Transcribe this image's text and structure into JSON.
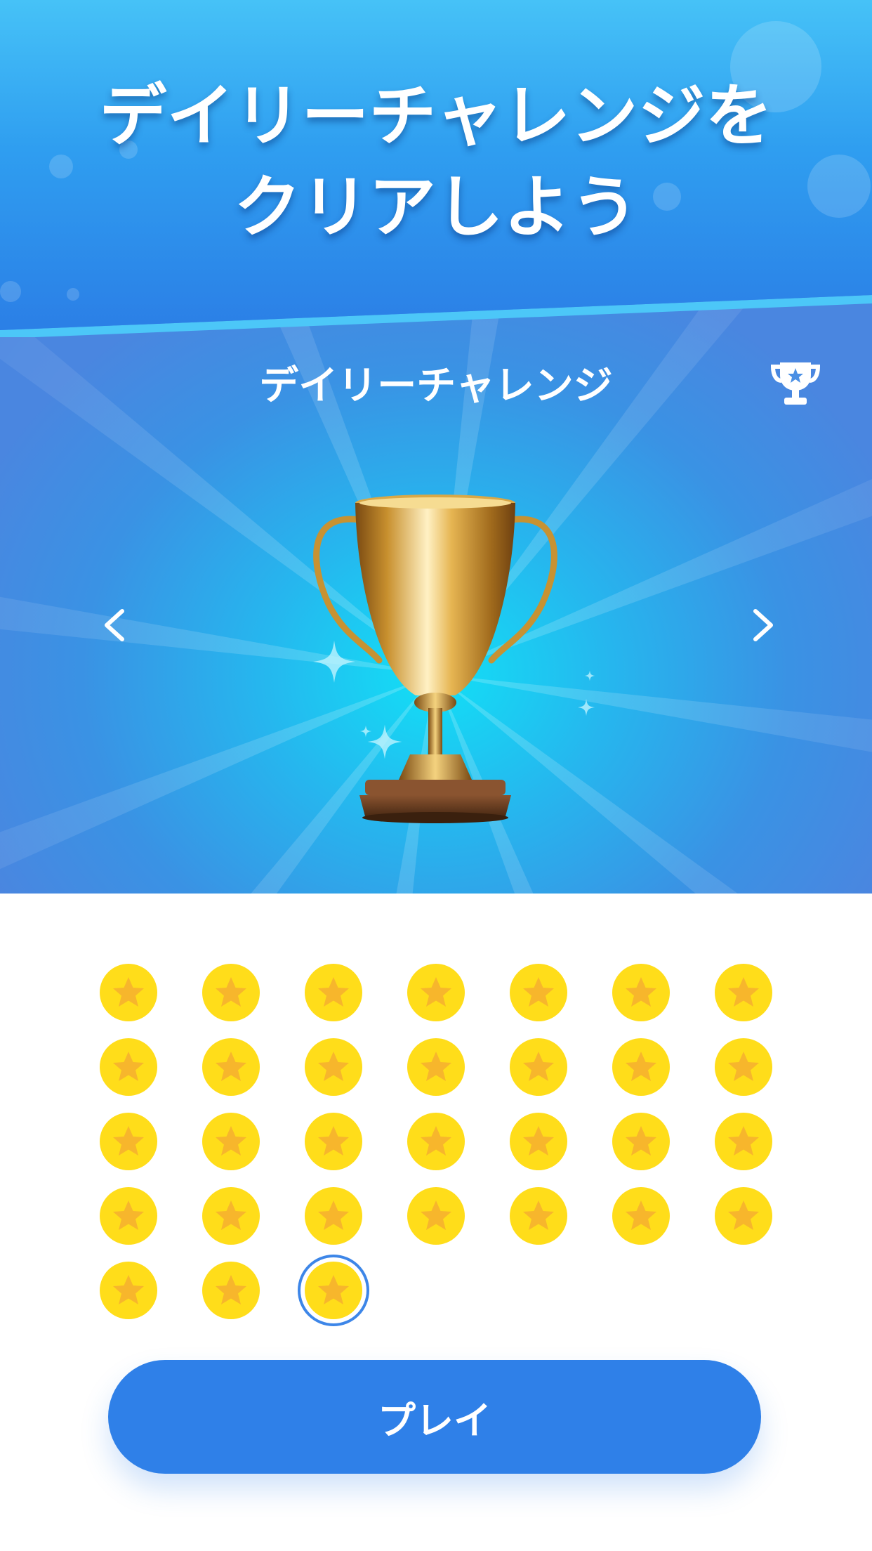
{
  "promo": {
    "title_line1": "デイリーチャレンジを",
    "title_line2": "クリアしよう"
  },
  "challenge": {
    "title": "デイリーチャレンジ",
    "trophy_button_icon": "trophy-star-icon",
    "prev_icon": "chevron-left-icon",
    "next_icon": "chevron-right-icon",
    "hero_image": "golden-trophy"
  },
  "stars": {
    "columns": 7,
    "completed_count": 31,
    "selected_index": 30,
    "icon": "star-coin-icon"
  },
  "play_button": {
    "label": "プレイ"
  },
  "colors": {
    "promo_top": "#46c2f7",
    "promo_bottom": "#2b7fe6",
    "hero_glow": "#12e0f6",
    "hero_edge": "#4a86e0",
    "coin": "#ffdd1a",
    "coin_star": "#f7b62c",
    "selected_ring": "#3d86e8",
    "play_button": "#2f80e8"
  }
}
